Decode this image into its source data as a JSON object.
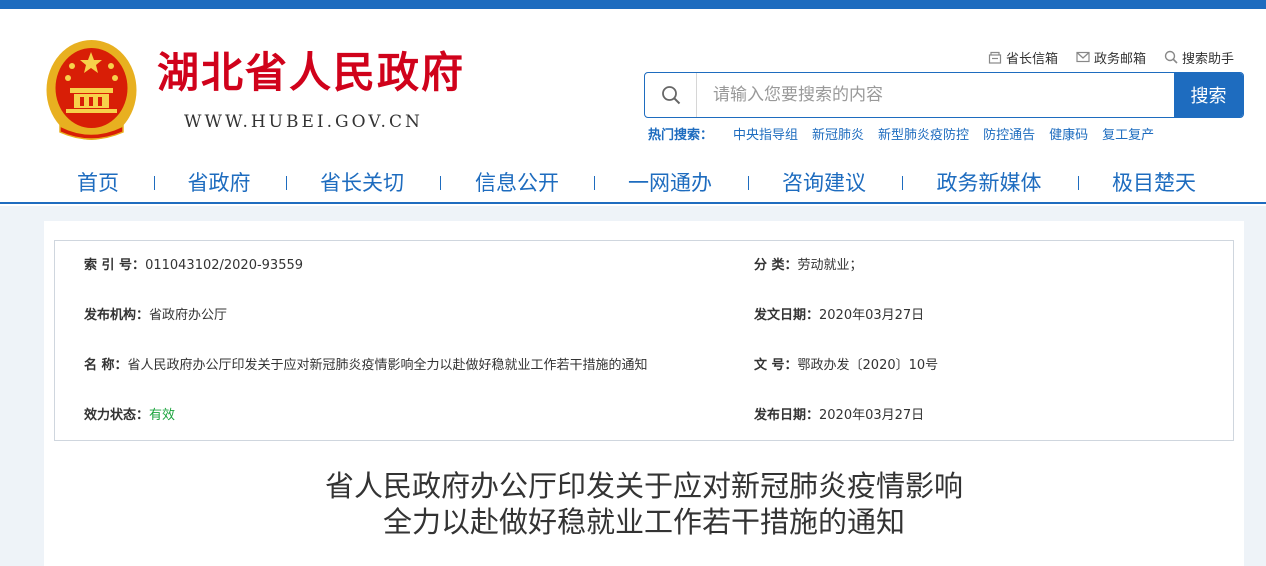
{
  "header": {
    "site_title": "湖北省人民政府",
    "site_url": "WWW.HUBEI.GOV.CN",
    "emblem_icon": "national-emblem-icon"
  },
  "utility_links": [
    {
      "label": "省长信箱",
      "icon": "mailbox-icon"
    },
    {
      "label": "政务邮箱",
      "icon": "envelope-icon"
    },
    {
      "label": "搜索助手",
      "icon": "search-icon"
    }
  ],
  "search": {
    "placeholder": "请输入您要搜索的内容",
    "value": "",
    "button_label": "搜索"
  },
  "hot_search": {
    "label": "热门搜索：",
    "items": [
      "中央指导组",
      "新冠肺炎",
      "新型肺炎疫防控",
      "防控通告",
      "健康码",
      "复工复产"
    ]
  },
  "nav": {
    "items": [
      "首页",
      "省政府",
      "省长关切",
      "信息公开",
      "一网通办",
      "咨询建议",
      "政务新媒体",
      "极目楚天"
    ]
  },
  "meta": {
    "index_label": "索 引 号：",
    "index_value": "011043102/2020-93559",
    "category_label": "分    类：",
    "category_value": "劳动就业；",
    "issuer_label": "发布机构：",
    "issuer_value": "省政府办公厅",
    "issue_date_label": "发文日期：",
    "issue_date_value": "2020年03月27日",
    "name_label": "名    称：",
    "name_value": "省人民政府办公厅印发关于应对新冠肺炎疫情影响全力以赴做好稳就业工作若干措施的通知",
    "doc_no_label": "文    号：",
    "doc_no_value": "鄂政办发〔2020〕10号",
    "status_label": "效力状态：",
    "status_value": "有效",
    "publish_date_label": "发布日期：",
    "publish_date_value": "2020年03月27日"
  },
  "document": {
    "title_line1": "省人民政府办公厅印发关于应对新冠肺炎疫情影响",
    "title_line2": "全力以赴做好稳就业工作若干措施的通知"
  },
  "colors": {
    "brand_blue": "#1e6cbf",
    "title_red": "#d0021b",
    "valid_green": "#1aa33c"
  }
}
